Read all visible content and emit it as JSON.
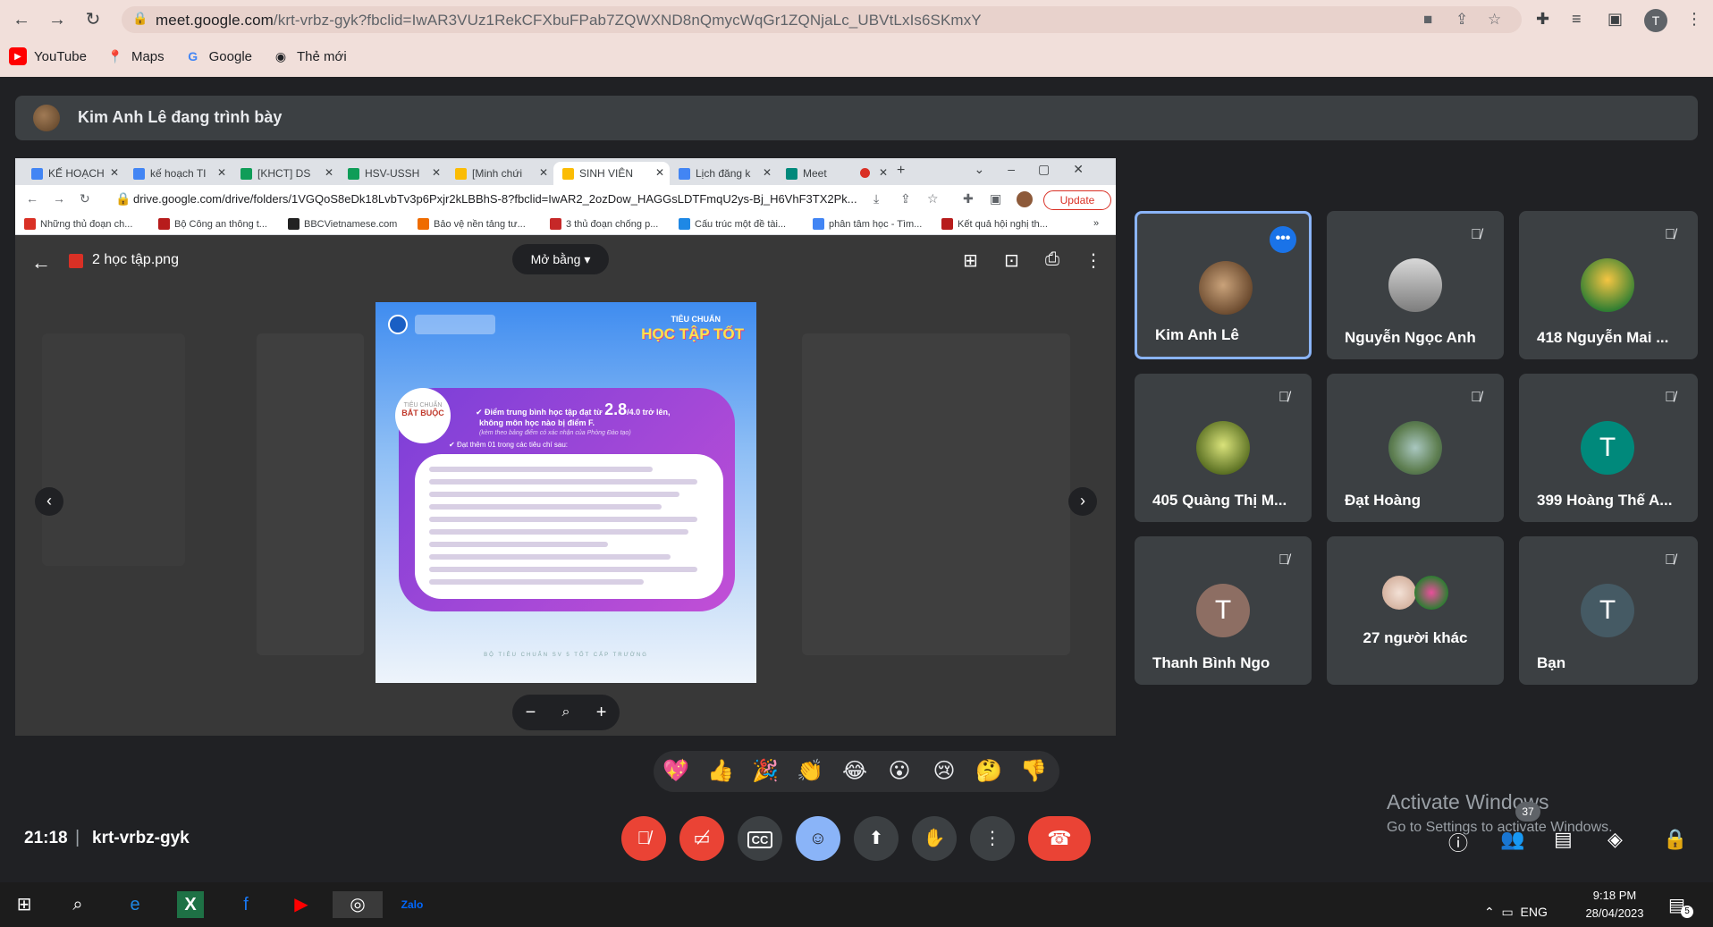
{
  "browser": {
    "url_host": "meet.google.com",
    "url_rest": "/krt-vrbz-gyk?fbclid=IwAR3VUz1RekCFXbuFPab7ZQWXND8nQmycWqGr1ZQNjaLc_UBVtLxIs6SKmxY",
    "profile_initial": "T",
    "bookmarks": [
      "YouTube",
      "Maps",
      "Google",
      "Thẻ mới"
    ]
  },
  "presenter": {
    "text": "Kim Anh Lê đang trình bày"
  },
  "shared": {
    "tabs": [
      {
        "label": "KẾ HOẠCH"
      },
      {
        "label": "kế hoạch TI"
      },
      {
        "label": "[KHCT] DS"
      },
      {
        "label": "HSV-USSH"
      },
      {
        "label": "[Minh chứi"
      },
      {
        "label": "SINH VIÊN"
      },
      {
        "label": "Lịch đăng k"
      },
      {
        "label": "Meet"
      }
    ],
    "url": "drive.google.com/drive/folders/1VGQoS8eDk18LvbTv3p6Pxjr2kLBBhS-8?fbclid=IwAR2_2ozDow_HAGGsLDTFmqU2ys-Bj_H6VhF3TX2Pk...",
    "update_label": "Update",
    "bookmarks": [
      "Những thủ đoạn ch...",
      "Bộ Công an thông t...",
      "BBCVietnamese.com",
      "Bảo vệ nền tảng tư...",
      "3 thủ đoạn chống p...",
      "Cấu trúc một đề tài...",
      "phân tâm học - Tìm...",
      "Kết quả hội nghị th..."
    ],
    "file_name": "2 học tập.png",
    "open_with": "Mở bằng",
    "poster": {
      "title_small": "TIÊU CHUẨN",
      "title_big": "HỌC TẬP TỐT",
      "badge_top": "TIÊU CHUẨN",
      "badge_main": "BẮT BUỘC",
      "line1_pre": "Điểm trung bình học tập đạt từ",
      "line1_num": "2.8",
      "line1_post": "/4.0 trở lên,",
      "line2": "không môn học nào bị điểm F.",
      "line3": "(kèm theo bảng điểm có xác nhận của Phòng Đào tạo)",
      "line4": "Đạt thêm 01 trong các tiêu chí sau:",
      "footer": "BỘ TIÊU CHUẨN SV 5 TỐT CẤP TRƯỜNG"
    }
  },
  "participants": [
    {
      "name": "Kim Anh Lê"
    },
    {
      "name": "Nguyễn Ngọc Anh"
    },
    {
      "name": "418 Nguyễn Mai ..."
    },
    {
      "name": "405 Quàng Thị M..."
    },
    {
      "name": "Đạt Hoàng"
    },
    {
      "name": "399 Hoàng Thế A...",
      "initial": "T"
    },
    {
      "name": "Thanh Bình Ngo",
      "initial": "T"
    },
    {
      "name": "27 người khác"
    },
    {
      "name": "Bạn",
      "initial": "T"
    }
  ],
  "meeting": {
    "time": "21:18",
    "code": "krt-vrbz-gyk",
    "people_count": "37"
  },
  "watermark": {
    "line1": "Activate Windows",
    "line2": "Go to Settings to activate Windows."
  },
  "taskbar": {
    "lang": "ENG",
    "time": "9:18 PM",
    "date": "28/04/2023",
    "notifications": "5"
  },
  "colors": {
    "accent": "#8ab4f8",
    "danger": "#ea4335",
    "meet_bg": "#202124",
    "tile": "#3c4043"
  }
}
